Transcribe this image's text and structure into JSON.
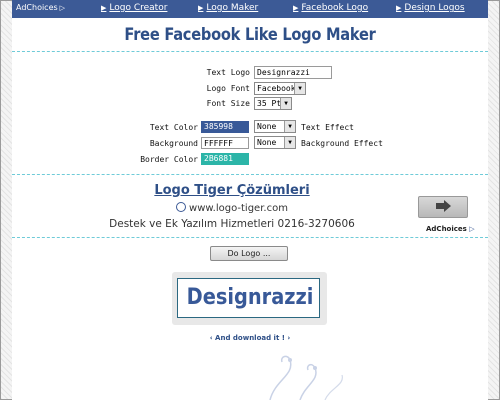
{
  "nav": {
    "adchoices": "AdChoices",
    "links": [
      "Logo Creator",
      "Logo Maker",
      "Facebook Logo",
      "Design Logos"
    ]
  },
  "page_title": "Free Facebook Like Logo Maker",
  "form": {
    "text_logo_label": "Text Logo",
    "text_logo_value": "Designrazzi",
    "logo_font_label": "Logo Font",
    "logo_font_value": "Facebook",
    "font_size_label": "Font Size",
    "font_size_value": "35 Pt",
    "text_color_label": "Text Color",
    "text_color_value": "385998",
    "text_effect_select": "None",
    "text_effect_label": "Text Effect",
    "background_label": "Background",
    "background_value": "FFFFFF",
    "background_effect_select": "None",
    "background_effect_label": "Background Effect",
    "border_color_label": "Border Color",
    "border_color_value": "2B6881"
  },
  "colors": {
    "text_color": "#385998",
    "border_color": "#2B6881",
    "background": "#FFFFFF",
    "nav_bg": "#3c5a96",
    "divider": "#6fcbd8"
  },
  "ad": {
    "title": "Logo Tiger Çözümleri",
    "url": "www.logo-tiger.com",
    "description": "Destek ve Ek Yazılım Hizmetleri 0216-3270606",
    "adchoices": "AdChoices"
  },
  "do_logo_button": "Do Logo ...",
  "logo_preview_text": "Designrazzi",
  "download_link": "‹ And download it ! ›"
}
